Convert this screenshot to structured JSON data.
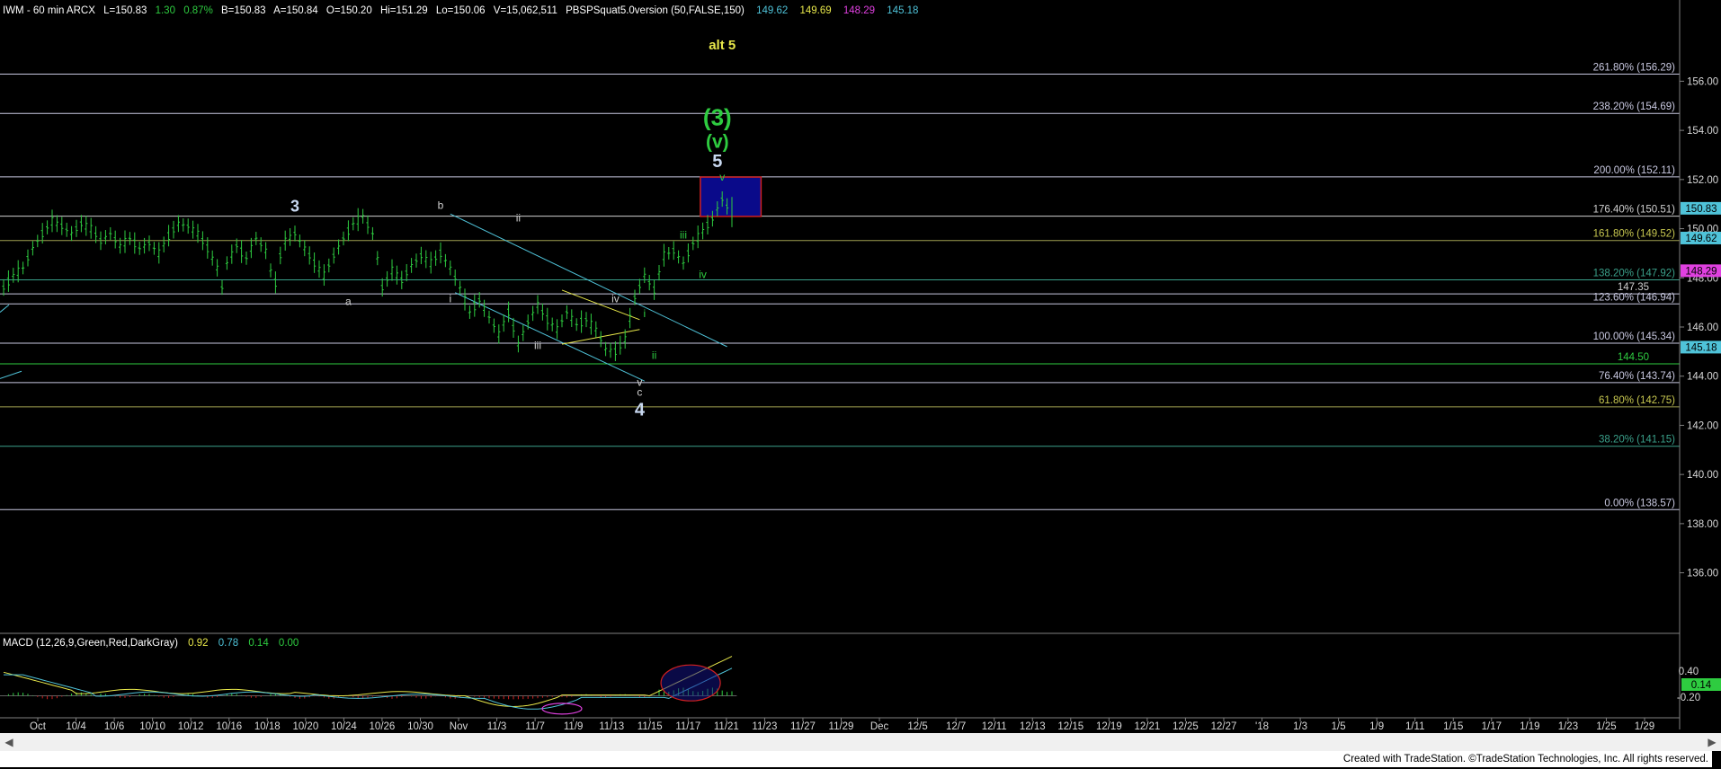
{
  "header": {
    "symbol": "IWM - 60 min  ARCX",
    "last": "L=150.83",
    "change": "1.30",
    "pct": "0.87%",
    "bid": "B=150.83",
    "ask": "A=150.84",
    "open": "O=150.20",
    "high": "Hi=151.29",
    "low": "Lo=150.06",
    "volume": "V=15,062,511",
    "study": "PBSPSquat5.0version (50,FALSE,150)",
    "study_values": [
      {
        "text": "149.62",
        "color": "#4fc3d9"
      },
      {
        "text": "149.69",
        "color": "#e8e84a"
      },
      {
        "text": "148.29",
        "color": "#e040e0"
      },
      {
        "text": "145.18",
        "color": "#4fc3d9"
      }
    ]
  },
  "macd": {
    "label": "MACD (12,26,9,Green,Red,DarkGray)",
    "values": [
      {
        "text": "0.92",
        "color": "#e8e84a"
      },
      {
        "text": "0.78",
        "color": "#4fc3d9"
      },
      {
        "text": "0.14",
        "color": "#2ecc40"
      },
      {
        "text": "0.00",
        "color": "#2ecc40"
      }
    ],
    "axis_ticks": [
      "0.40",
      "-0.20"
    ],
    "last_value": "0.14"
  },
  "chart_data": {
    "type": "line",
    "title": "IWM - 60 min",
    "ylim": [
      133.5,
      158.5
    ],
    "y_ticks": [
      136,
      138,
      140,
      142,
      144,
      146,
      148,
      150,
      152,
      154,
      156
    ],
    "y_tick_labels": [
      "136.00",
      "138.00",
      "140.00",
      "142.00",
      "144.00",
      "146.00",
      "148.00",
      "150.00",
      "152.00",
      "154.00",
      "156.00"
    ],
    "x_labels": [
      "Oct",
      "10/4",
      "10/6",
      "10/10",
      "10/12",
      "10/16",
      "10/18",
      "10/20",
      "10/24",
      "10/26",
      "10/30",
      "Nov",
      "11/3",
      "11/7",
      "11/9",
      "11/13",
      "11/15",
      "11/17",
      "11/21",
      "11/23",
      "11/27",
      "11/29",
      "Dec",
      "12/5",
      "12/7",
      "12/11",
      "12/13",
      "12/15",
      "12/19",
      "12/21",
      "12/25",
      "12/27",
      "'18",
      "1/3",
      "1/5",
      "1/9",
      "1/11",
      "1/15",
      "1/17",
      "1/19",
      "1/23",
      "1/25",
      "1/29"
    ],
    "price_path": [
      [
        0,
        147.6
      ],
      [
        2,
        148.1
      ],
      [
        4,
        148.4
      ],
      [
        6,
        149.2
      ],
      [
        8,
        149.8
      ],
      [
        10,
        150.3
      ],
      [
        12,
        150.1
      ],
      [
        14,
        149.8
      ],
      [
        16,
        150.2
      ],
      [
        18,
        150.0
      ],
      [
        20,
        149.5
      ],
      [
        22,
        149.8
      ],
      [
        24,
        149.3
      ],
      [
        26,
        149.6
      ],
      [
        28,
        149.2
      ],
      [
        30,
        149.4
      ],
      [
        32,
        149.0
      ],
      [
        34,
        149.7
      ],
      [
        36,
        150.2
      ],
      [
        38,
        150.1
      ],
      [
        40,
        149.8
      ],
      [
        42,
        149.2
      ],
      [
        44,
        148.4
      ],
      [
        45,
        147.6
      ],
      [
        46,
        148.6
      ],
      [
        48,
        149.3
      ],
      [
        50,
        148.8
      ],
      [
        52,
        149.6
      ],
      [
        54,
        149.1
      ],
      [
        55,
        148.3
      ],
      [
        56,
        147.8
      ],
      [
        57,
        148.9
      ],
      [
        58,
        149.5
      ],
      [
        60,
        149.8
      ],
      [
        62,
        149.2
      ],
      [
        64,
        148.6
      ],
      [
        66,
        148.1
      ],
      [
        68,
        148.9
      ],
      [
        70,
        149.6
      ],
      [
        72,
        150.2
      ],
      [
        74,
        150.5
      ],
      [
        76,
        149.8
      ],
      [
        77,
        148.8
      ],
      [
        78,
        147.6
      ],
      [
        80,
        148.3
      ],
      [
        82,
        147.9
      ],
      [
        84,
        148.5
      ],
      [
        86,
        148.9
      ],
      [
        88,
        148.6
      ],
      [
        90,
        149.0
      ],
      [
        92,
        148.4
      ],
      [
        94,
        147.6
      ],
      [
        96,
        146.6
      ],
      [
        98,
        147.1
      ],
      [
        100,
        146.4
      ],
      [
        102,
        145.7
      ],
      [
        104,
        146.6
      ],
      [
        106,
        145.3
      ],
      [
        108,
        146.2
      ],
      [
        110,
        146.9
      ],
      [
        112,
        146.3
      ],
      [
        114,
        145.9
      ],
      [
        116,
        146.6
      ],
      [
        118,
        146.1
      ],
      [
        120,
        146.3
      ],
      [
        122,
        145.9
      ],
      [
        124,
        145.1
      ],
      [
        126,
        145.0
      ],
      [
        128,
        145.5
      ],
      [
        130,
        147.2
      ],
      [
        132,
        148.1
      ],
      [
        134,
        147.5
      ],
      [
        136,
        148.9
      ],
      [
        138,
        149.1
      ],
      [
        140,
        148.6
      ],
      [
        142,
        149.4
      ],
      [
        144,
        149.9
      ],
      [
        146,
        150.4
      ],
      [
        148,
        151.2
      ],
      [
        149,
        150.9
      ],
      [
        150,
        150.83
      ]
    ],
    "price_path_x_range": [
      0,
      150
    ],
    "fib_levels": [
      {
        "label": "261.80% (156.29)",
        "value": 156.29,
        "line": "#c8c8e0",
        "text": "#c8c8e0"
      },
      {
        "label": "238.20% (154.69)",
        "value": 154.69,
        "line": "#c8c8e0",
        "text": "#c8c8e0"
      },
      {
        "label": "200.00% (152.11)",
        "value": 152.11,
        "line": "#c8c8e0",
        "text": "#c8c8e0"
      },
      {
        "label": "176.40% (150.51)",
        "value": 150.51,
        "line": "#d0d0d0",
        "text": "#d0d0d0"
      },
      {
        "label": "161.80% (149.52)",
        "value": 149.52,
        "line": "#a0a050",
        "text": "#c8c850"
      },
      {
        "label": "138.20% (147.92)",
        "value": 147.92,
        "line": "#3aa08a",
        "text": "#3aa08a"
      },
      {
        "label": "123.60% (146.94)",
        "value": 146.94,
        "line": "#c8c8e0",
        "text": "#c8c8e0"
      },
      {
        "label": "100.00% (145.34)",
        "value": 145.34,
        "line": "#c8c8e0",
        "text": "#c8c8e0"
      },
      {
        "label": "76.40% (143.74)",
        "value": 143.74,
        "line": "#c8c8e0",
        "text": "#c8c8e0"
      },
      {
        "label": "61.80% (142.75)",
        "value": 142.75,
        "line": "#a0a050",
        "text": "#c8c850"
      },
      {
        "label": "38.20% (141.15)",
        "value": 141.15,
        "line": "#3aa08a",
        "text": "#3aa08a"
      },
      {
        "label": "0.00% (138.57)",
        "value": 138.57,
        "line": "#c8c8e0",
        "text": "#c8c8e0"
      }
    ],
    "extra_levels": [
      {
        "label": "147.35",
        "value": 147.35,
        "line": "#c8c8e0",
        "text": "#d0d0d0"
      },
      {
        "label": "144.50",
        "value": 144.5,
        "line": "#2ecc40",
        "text": "#2ecc40"
      }
    ],
    "price_badges": [
      {
        "text": "150.83",
        "value": 150.83,
        "bg": "#4fc3d9"
      },
      {
        "text": "149.62",
        "value": 149.62,
        "bg": "#4fc3d9"
      },
      {
        "text": "148.29",
        "value": 148.29,
        "bg": "#e040e0"
      },
      {
        "text": "145.18",
        "value": 145.18,
        "bg": "#4fc3d9"
      }
    ],
    "target_box": {
      "top": 152.1,
      "bottom": 150.5,
      "fill": "#0a0a8a",
      "stroke": "#d02020"
    },
    "annotations": [
      {
        "text": "alt 5",
        "x": 148,
        "y": 157.3,
        "color": "#e8e84a",
        "size": 15,
        "bold": true
      },
      {
        "text": "(3)",
        "x": 147,
        "y": 154.2,
        "color": "#2ecc40",
        "size": 26,
        "bold": true
      },
      {
        "text": "(v)",
        "x": 147,
        "y": 153.3,
        "color": "#2ecc40",
        "size": 21,
        "bold": true
      },
      {
        "text": "5",
        "x": 147,
        "y": 152.5,
        "color": "#c8d8f0",
        "size": 20,
        "bold": true
      },
      {
        "text": "v",
        "x": 148,
        "y": 151.95,
        "color": "#2ecc40",
        "size": 12,
        "bold": false
      },
      {
        "text": "3",
        "x": 60,
        "y": 150.7,
        "color": "#c8d8f0",
        "size": 18,
        "bold": true
      },
      {
        "text": "b",
        "x": 90,
        "y": 150.8,
        "color": "#d0d0d0",
        "size": 12,
        "bold": false
      },
      {
        "text": "ii",
        "x": 106,
        "y": 150.3,
        "color": "#d0d0d0",
        "size": 12,
        "bold": false
      },
      {
        "text": "a",
        "x": 71,
        "y": 146.9,
        "color": "#d0d0d0",
        "size": 12,
        "bold": false
      },
      {
        "text": "i",
        "x": 92,
        "y": 147.0,
        "color": "#d0d0d0",
        "size": 12,
        "bold": false
      },
      {
        "text": "iii",
        "x": 110,
        "y": 145.1,
        "color": "#d0d0d0",
        "size": 12,
        "bold": false
      },
      {
        "text": "iv",
        "x": 126,
        "y": 147.0,
        "color": "#d0d0d0",
        "size": 12,
        "bold": false
      },
      {
        "text": "i",
        "x": 132,
        "y": 146.4,
        "color": "#2ecc40",
        "size": 12,
        "bold": false
      },
      {
        "text": "ii",
        "x": 134,
        "y": 144.7,
        "color": "#2ecc40",
        "size": 12,
        "bold": false
      },
      {
        "text": "iii",
        "x": 140,
        "y": 149.6,
        "color": "#2ecc40",
        "size": 12,
        "bold": false
      },
      {
        "text": "iv",
        "x": 144,
        "y": 148.0,
        "color": "#2ecc40",
        "size": 12,
        "bold": false
      },
      {
        "text": "v",
        "x": 131,
        "y": 143.6,
        "color": "#d0d0d0",
        "size": 12,
        "bold": false
      },
      {
        "text": "c",
        "x": 131,
        "y": 143.2,
        "color": "#d0d0d0",
        "size": 12,
        "bold": false
      },
      {
        "text": "4",
        "x": 131,
        "y": 142.4,
        "color": "#c8d8f0",
        "size": 20,
        "bold": true
      }
    ],
    "channel_upper": [
      [
        92,
        150.6
      ],
      [
        149,
        145.2
      ]
    ],
    "channel_lower": [
      [
        93,
        147.4
      ],
      [
        132,
        143.8
      ]
    ],
    "triangle_top": [
      [
        115,
        147.5
      ],
      [
        131,
        146.3
      ]
    ],
    "triangle_bottom": [
      [
        115,
        145.3
      ],
      [
        131,
        145.9
      ]
    ]
  },
  "footer": {
    "credit": "Created with TradeStation. ©TradeStation Technologies, Inc. All rights reserved."
  }
}
